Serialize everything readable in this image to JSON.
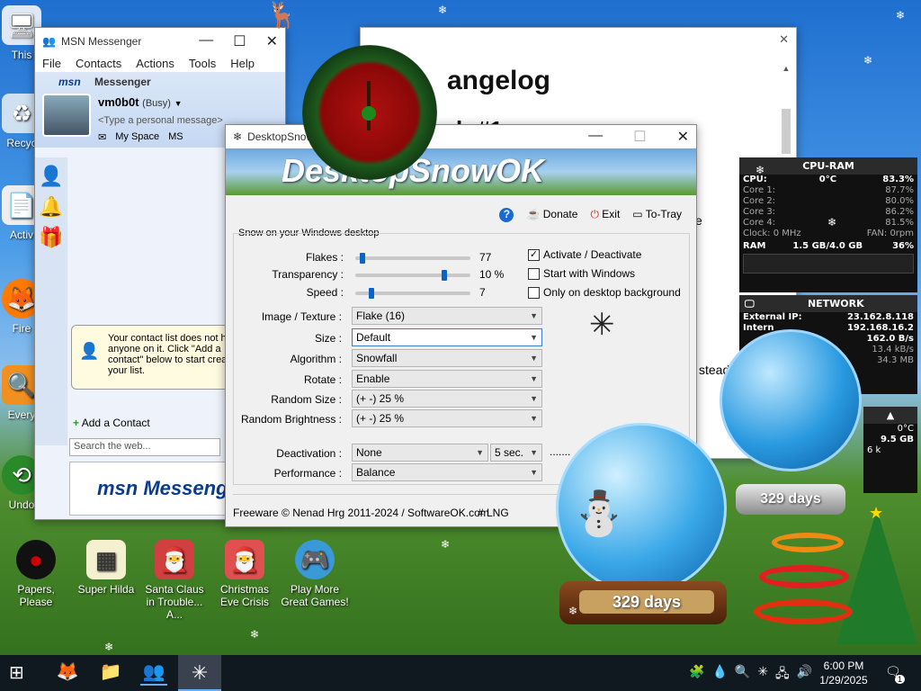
{
  "desktop": {
    "icons_left": [
      {
        "label": "This",
        "icon": "computer-icon"
      },
      {
        "label": "Recyc",
        "icon": "recycle-icon"
      },
      {
        "label": "Activ",
        "icon": "doc-icon"
      },
      {
        "label": "Fire",
        "icon": "firefox-icon"
      },
      {
        "label": "Every",
        "icon": "everything-icon"
      },
      {
        "label": "Undo",
        "icon": "undo-icon"
      }
    ],
    "icons_bottom": [
      {
        "label": "Papers, Please"
      },
      {
        "label": "Super Hilda"
      },
      {
        "label": "Santa Claus in Trouble... A..."
      },
      {
        "label": "Christmas Eve Crisis"
      },
      {
        "label": "Play More Great Games!"
      }
    ]
  },
  "msn": {
    "title": "MSN Messenger",
    "menu": [
      "File",
      "Contacts",
      "Actions",
      "Tools",
      "Help"
    ],
    "brand": "Messenger",
    "username": "vm0b0t",
    "status": "(Busy)",
    "personal_message": "<Type a personal message>",
    "toolbar": [
      "My Space",
      "MS"
    ],
    "notice": "Your contact list does not have anyone on it.  Click \"Add a contact\" below to start creating your list.",
    "add_contact": "Add a Contact",
    "search_placeholder": "Search the web...",
    "banner": "msn Messenger"
  },
  "changelog": {
    "heading": "angelog",
    "subheading": "h #1",
    "fragment1": "e",
    "fragment2": "stead"
  },
  "dso": {
    "title": "DesktopSnowOK",
    "banner": "DesktopSnowOK",
    "actions": [
      "Donate",
      "Exit",
      "To-Tray"
    ],
    "section": "Snow on your Windows desktop",
    "sliders": [
      {
        "label": "Flakes :",
        "value": "77",
        "pos": 0.08
      },
      {
        "label": "Transparency :",
        "value": "10 %",
        "pos": 0.78
      },
      {
        "label": "Speed :",
        "value": "7",
        "pos": 0.15
      }
    ],
    "checks": [
      {
        "label": "Activate / Deactivate",
        "checked": true
      },
      {
        "label": "Start with Windows",
        "checked": false
      },
      {
        "label": "Only on desktop background",
        "checked": false
      }
    ],
    "combos": [
      {
        "label": "Image / Texture :",
        "value": "Flake (16)"
      },
      {
        "label": "Size :",
        "value": "Default"
      },
      {
        "label": "Algorithm :",
        "value": "Snowfall"
      },
      {
        "label": "Rotate :",
        "value": "Enable"
      },
      {
        "label": "Random Size :",
        "value": "(+ -) 25 %"
      },
      {
        "label": "Random Brightness :",
        "value": "(+ -) 25 %"
      }
    ],
    "deactivation_label": "Deactivation :",
    "deactivation_value": "None",
    "deactivation_secs": "5 sec.",
    "deactivation_dots": ".......",
    "performance_label": "Performance :",
    "performance_value": "Balance",
    "footer": "Freeware © Nenad Hrg 2011-2024 / SoftwareOK.com",
    "lng": "# LNG"
  },
  "cpu_widget": {
    "title": "CPU-RAM",
    "rows": [
      {
        "label": "CPU:",
        "mid": "0°C",
        "value": "83.3%"
      },
      {
        "label": "Core 1:",
        "mid": "",
        "value": "87.7%"
      },
      {
        "label": "Core 2:",
        "mid": "",
        "value": "80.0%"
      },
      {
        "label": "Core 3:",
        "mid": "",
        "value": "86.2%"
      },
      {
        "label": "Core 4:",
        "mid": "",
        "value": "81.5%"
      },
      {
        "label": "Clock: 0 MHz",
        "mid": "",
        "value": "FAN: 0rpm"
      }
    ],
    "ram_label": "RAM",
    "ram_mid": "1.5 GB/4.0 GB",
    "ram_value": "36%"
  },
  "net_widget": {
    "title": "NETWORK",
    "rows": [
      {
        "label": "External IP:",
        "value": "23.162.8.118"
      },
      {
        "label": "Intern",
        "value": "192.168.16.2"
      },
      {
        "label": "",
        "value": "162.0 B/s"
      },
      {
        "label": "",
        "value": "13.4 kB/s"
      },
      {
        "label": "",
        "value": "34.3 MB"
      }
    ]
  },
  "disk_widget": {
    "rows": [
      "0°C",
      "9.5 GB",
      "6 k"
    ]
  },
  "globes": {
    "big_label": "329 days",
    "small_label": "329 days"
  },
  "taskbar": {
    "time": "6:00 PM",
    "date": "1/29/2025",
    "notification_count": "1"
  }
}
